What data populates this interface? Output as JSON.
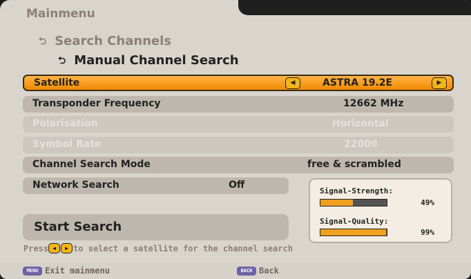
{
  "menu": {
    "title": "Mainmenu",
    "crumb_level1": "Search Channels",
    "crumb_level2": "Manual Channel Search"
  },
  "rows": {
    "satellite": {
      "label": "Satellite",
      "value": "ASTRA 19.2E"
    },
    "transponder": {
      "label": "Transponder Frequency",
      "value": "12662 MHz"
    },
    "polarisation": {
      "label": "Polarisation",
      "value": "Horizontal"
    },
    "symbol_rate": {
      "label": "Symbol Rate",
      "value": "22000"
    },
    "search_mode": {
      "label": "Channel Search Mode",
      "value": "free & scrambled"
    },
    "network_search": {
      "label": "Network Search",
      "value": "Off"
    }
  },
  "start_search_label": "Start Search",
  "signal": {
    "strength_label": "Signal-Strength:",
    "strength_pct": "49%",
    "strength_value": 0.49,
    "quality_label": "Signal-Quality:",
    "quality_pct": "99%",
    "quality_value": 0.99
  },
  "hint": {
    "prefix": "Press",
    "suffix": "to select a satellite for the channel search"
  },
  "footer": {
    "menu_key": "MENU",
    "menu_label": "Exit mainmenu",
    "back_key": "BACK",
    "back_label": "Back"
  },
  "colors": {
    "accent": "#f08a00",
    "panel": "#d9d4cc",
    "row": "#bdb7ae"
  }
}
